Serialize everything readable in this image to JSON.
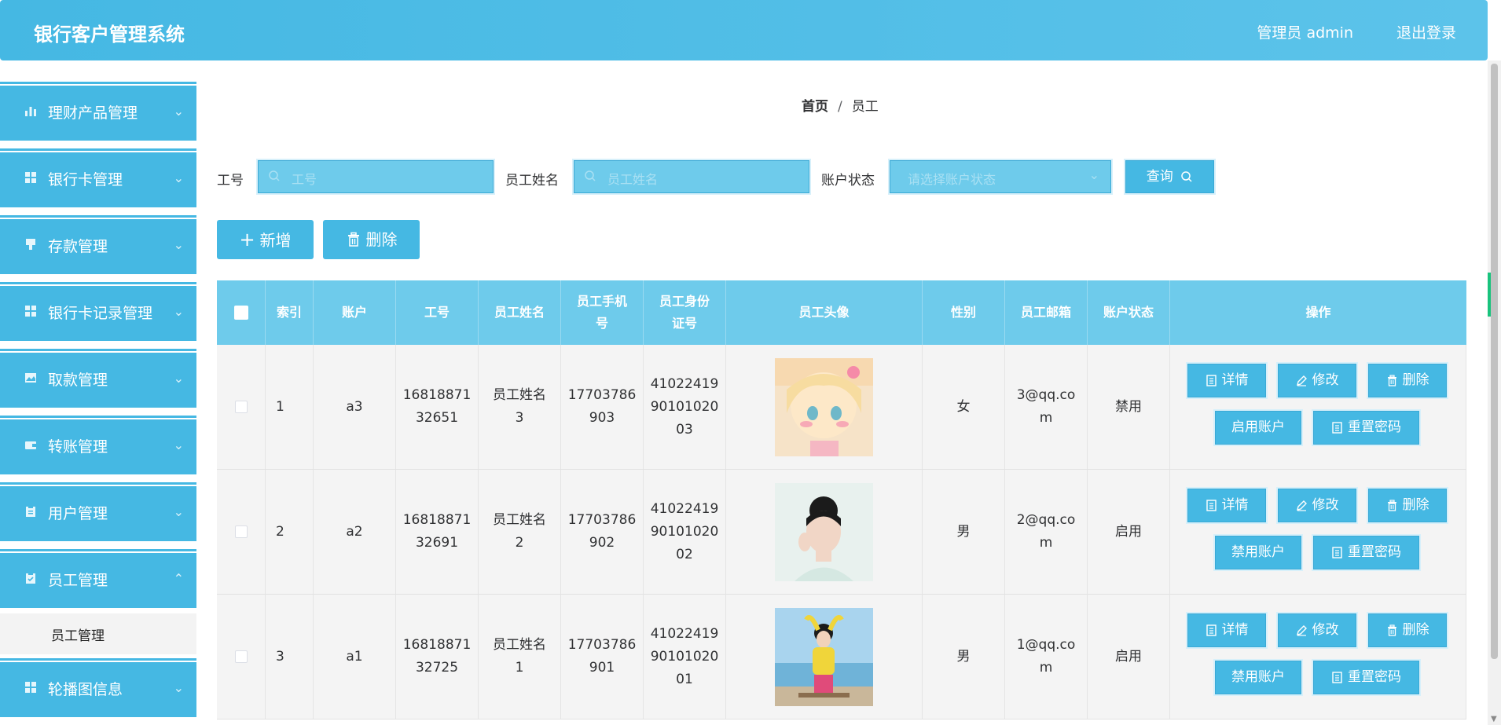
{
  "header": {
    "title": "银行客户管理系统",
    "admin": "管理员 admin",
    "logout": "退出登录"
  },
  "sidebar": {
    "items": [
      {
        "label": "理财产品管理",
        "icon": "bar-chart-icon"
      },
      {
        "label": "银行卡管理",
        "icon": "grid-icon"
      },
      {
        "label": "存款管理",
        "icon": "stamp-icon"
      },
      {
        "label": "银行卡记录管理",
        "icon": "grid-icon"
      },
      {
        "label": "取款管理",
        "icon": "picture-icon"
      },
      {
        "label": "转账管理",
        "icon": "wallet-icon"
      },
      {
        "label": "用户管理",
        "icon": "clipboard-icon"
      },
      {
        "label": "员工管理",
        "icon": "clipboard-check-icon"
      },
      {
        "label": "轮播图信息",
        "icon": "grid-icon"
      }
    ],
    "submenu": {
      "label": "员工管理"
    }
  },
  "breadcrumb": {
    "home": "首页",
    "sep": "/",
    "current": "员工"
  },
  "filters": {
    "job_no_label": "工号",
    "job_no_placeholder": "工号",
    "name_label": "员工姓名",
    "name_placeholder": "员工姓名",
    "status_label": "账户状态",
    "status_placeholder": "请选择账户状态",
    "query": "查询"
  },
  "actions": {
    "add": "新增",
    "delete": "删除"
  },
  "table": {
    "headers": [
      "索引",
      "账户",
      "工号",
      "员工姓名",
      "员工手机号",
      "员工身份证号",
      "员工头像",
      "性别",
      "员工邮箱",
      "账户状态",
      "操作"
    ],
    "rows": [
      {
        "index": "1",
        "account": "a3",
        "job_no": "1681887132651",
        "name": "员工姓名3",
        "phone": "17703786903",
        "id_card": "410224199010102003",
        "gender": "女",
        "email": "3@qq.com",
        "status": "禁用",
        "toggle": "启用账户"
      },
      {
        "index": "2",
        "account": "a2",
        "job_no": "1681887132691",
        "name": "员工姓名2",
        "phone": "17703786902",
        "id_card": "410224199010102002",
        "gender": "男",
        "email": "2@qq.com",
        "status": "启用",
        "toggle": "禁用账户"
      },
      {
        "index": "3",
        "account": "a1",
        "job_no": "1681887132725",
        "name": "员工姓名1",
        "phone": "17703786901",
        "id_card": "410224199010102001",
        "gender": "男",
        "email": "1@qq.com",
        "status": "启用",
        "toggle": "禁用账户"
      }
    ],
    "op_labels": {
      "detail": "详情",
      "edit": "修改",
      "delete": "删除",
      "reset": "重置密码"
    }
  },
  "colors": {
    "primary": "#45b8e3",
    "header_row": "#6ecbeb",
    "row_bg": "#f4f4f4"
  }
}
